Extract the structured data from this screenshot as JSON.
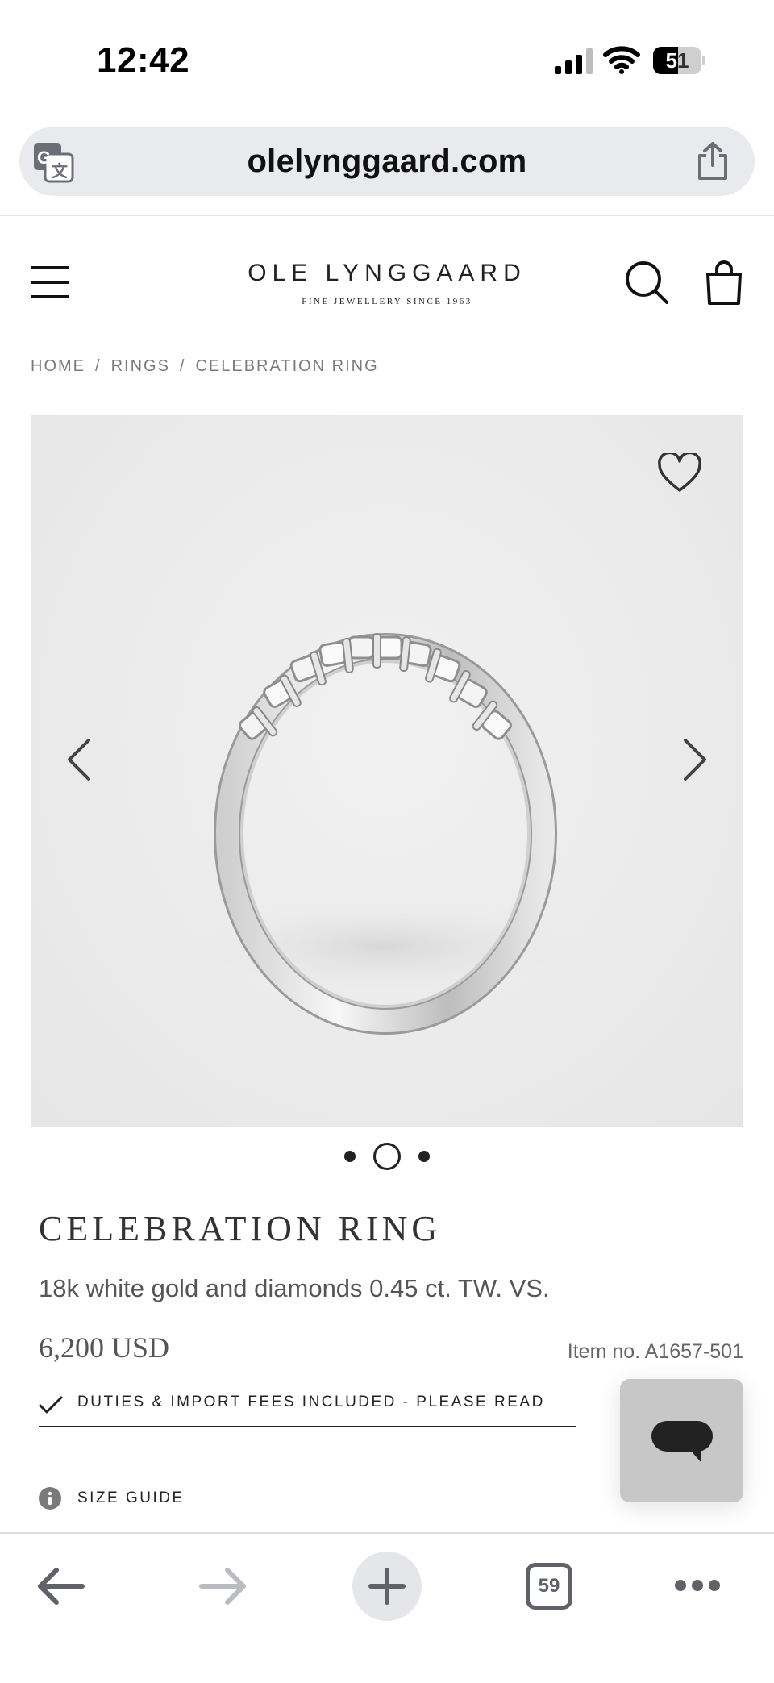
{
  "status_bar": {
    "time": "12:42",
    "battery_level": 51,
    "battery_text": "51",
    "icons": [
      "cellular-signal-icon",
      "wifi-icon",
      "battery-icon"
    ]
  },
  "browser": {
    "url": "olelynggaard.com",
    "icons": [
      "translate-icon",
      "share-icon"
    ]
  },
  "header": {
    "logo_main": "OLE LYNGGAARD",
    "logo_sub": "FINE JEWELLERY SINCE 1963",
    "icons": [
      "menu-icon",
      "search-icon",
      "shopping-bag-icon"
    ]
  },
  "breadcrumb": {
    "items": [
      "HOME",
      "RINGS",
      "CELEBRATION RING"
    ],
    "separator": "/"
  },
  "gallery": {
    "slide_count": 3,
    "active_slide": 2,
    "icons": [
      "heart-icon",
      "chevron-left-icon",
      "chevron-right-icon"
    ]
  },
  "product": {
    "title": "CELEBRATION RING",
    "description": "18k white gold and diamonds 0.45 ct. TW. VS.",
    "price": "6,200 USD",
    "item_number": "Item no. A1657-501",
    "duties_text": "DUTIES & IMPORT FEES INCLUDED - PLEASE READ",
    "size_guide": "SIZE GUIDE"
  },
  "toolbar": {
    "tab_count": "59",
    "icons": [
      "back-arrow-icon",
      "forward-arrow-icon",
      "plus-icon",
      "tabs-icon",
      "more-icon"
    ]
  },
  "colors": {
    "accent": "#222222",
    "url_bar_bg": "#e8eaed",
    "image_bg": "#ececec",
    "chat_widget_bg": "#c7c7c7",
    "muted_text": "#7a7a7a",
    "toolbar_gray": "#5f6368",
    "disabled_gray": "#b9bcc1"
  }
}
